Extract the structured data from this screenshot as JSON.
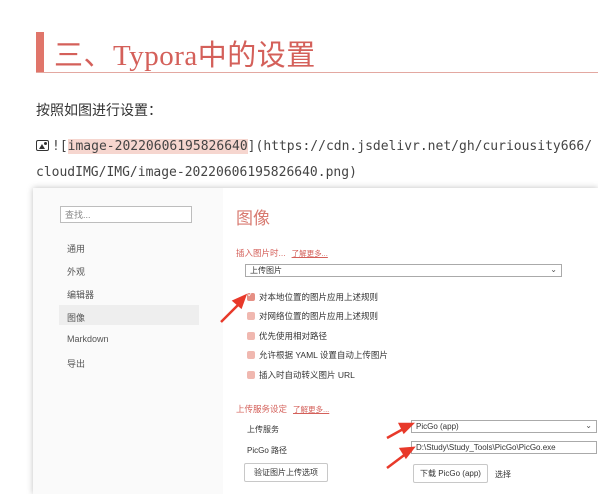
{
  "heading": "三、Typora中的设置",
  "intro": "按照如图进行设置：",
  "markdown": {
    "prefix": "![",
    "alt": "image-20220606195826640",
    "line1_rest": "](https://cdn.jsdelivr.net/gh/curiousity666/",
    "line2": "cloudIMG/IMG/image-20220606195826640.png)"
  },
  "settings": {
    "search_placeholder": "查找...",
    "nav": [
      "通用",
      "外观",
      "编辑器",
      "图像",
      "Markdown",
      "导出"
    ],
    "active_nav_index": 3,
    "page_title": "图像",
    "insert_section": {
      "title": "插入图片时...",
      "more": "了解更多..."
    },
    "insert_action": "上传图片",
    "options": [
      {
        "label": "对本地位置的图片应用上述规则",
        "checked": true
      },
      {
        "label": "对网络位置的图片应用上述规则",
        "checked": false
      },
      {
        "label": "优先使用相对路径",
        "checked": false
      },
      {
        "label": "允许根据 YAML 设置自动上传图片",
        "checked": false
      },
      {
        "label": "插入时自动转义图片 URL",
        "checked": false
      }
    ],
    "upload_section": {
      "title": "上传服务设定",
      "more": "了解更多..."
    },
    "upload_service_label": "上传服务",
    "upload_service_value": "PicGo (app)",
    "picgo_path_label": "PicGo 路径",
    "picgo_path_value": "D:\\Study\\Study_Tools\\PicGo\\PicGo.exe",
    "verify_button": "验证图片上传选项",
    "download_button": "下载 PicGo (app)",
    "select_link": "选择"
  },
  "colors": {
    "accent": "#d4605a",
    "arrow": "#e8392a",
    "checkbox": "#e58f84"
  }
}
